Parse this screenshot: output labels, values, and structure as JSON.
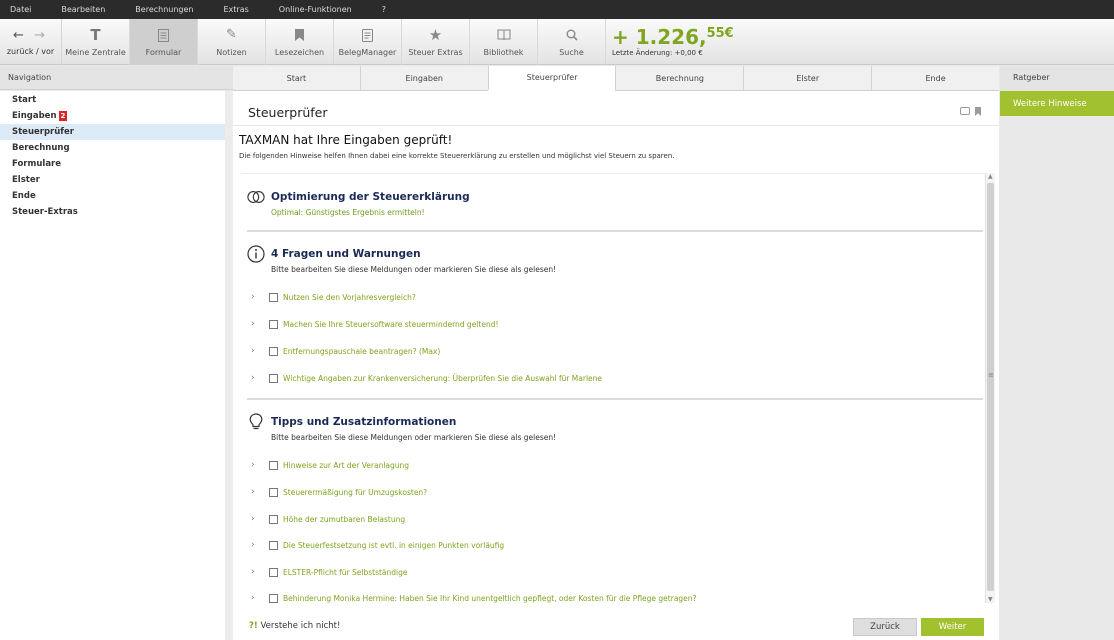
{
  "menu": [
    "Datei",
    "Bearbeiten",
    "Berechnungen",
    "Extras",
    "Online-Funktionen",
    "?"
  ],
  "toolbar": {
    "nav_label": "zurück / vor",
    "buttons": [
      {
        "label": "Meine Zentrale",
        "icon": "text-icon"
      },
      {
        "label": "Formular",
        "icon": "form-icon"
      },
      {
        "label": "Notizen",
        "icon": "pencil-icon"
      },
      {
        "label": "Lesezeichen",
        "icon": "bookmark-icon"
      },
      {
        "label": "BelegManager",
        "icon": "document-icon"
      },
      {
        "label": "Steuer Extras",
        "icon": "star-icon"
      },
      {
        "label": "Bibliothek",
        "icon": "book-icon"
      },
      {
        "label": "Suche",
        "icon": "search-icon"
      }
    ],
    "refund_main": "+ 1.226,",
    "refund_cents": "55€",
    "last_change": "Letzte Änderung: +0,00 €"
  },
  "nav": {
    "header": "Navigation",
    "items": [
      "Start",
      "Eingaben",
      "Steuerprüfer",
      "Berechnung",
      "Formulare",
      "Elster",
      "Ende",
      "Steuer-Extras"
    ],
    "badge": "2"
  },
  "tabs": [
    "Start",
    "Eingaben",
    "Steuerprüfer",
    "Berechnung",
    "Elster",
    "Ende"
  ],
  "right": {
    "header": "Ratgeber",
    "button": "Weitere Hinweise"
  },
  "main": {
    "title": "Steuerprüfer",
    "headline": "TAXMAN hat Ihre Eingaben geprüft!",
    "subline": "Die folgenden Hinweise helfen Ihnen dabei eine korrekte Steuererklärung zu erstellen und möglichst viel Steuern zu sparen.",
    "sec1": {
      "title": "Optimierung der Steuererklärung",
      "sub": "Optimal: Günstigstes Ergebnis ermitteln!"
    },
    "sec2": {
      "title": "4 Fragen und Warnungen",
      "sub": "Bitte bearbeiten Sie diese Meldungen oder markieren Sie diese als gelesen!",
      "items": [
        "Nutzen Sie den Vorjahresvergleich?",
        "Machen Sie Ihre Steuersoftware steuermindernd geltend!",
        "Entfernungspauschale beantragen? (Max)",
        "Wichtige Angaben zur Krankenversicherung: Überprüfen Sie die Auswahl für Marlene"
      ]
    },
    "sec3": {
      "title": "Tipps und Zusatzinformationen",
      "sub": "Bitte bearbeiten Sie diese Meldungen oder markieren Sie diese als gelesen!",
      "items": [
        "Hinweise zur Art der Veranlagung",
        "Steuerermäßigung für Umzugskosten?",
        "Höhe der zumutbaren Belastung",
        "Die Steuerfestsetzung ist evtl. in einigen Punkten vorläufig",
        "ELSTER-Pflicht für Selbstständige",
        "Behinderung Monika Hermine: Haben Sie Ihr Kind unentgeltlich gepflegt, oder Kosten für die Pflege getragen?"
      ]
    },
    "understand_mark": "?!",
    "understand": "Verstehe ich nicht!",
    "back": "Zurück",
    "next": "Weiter"
  }
}
